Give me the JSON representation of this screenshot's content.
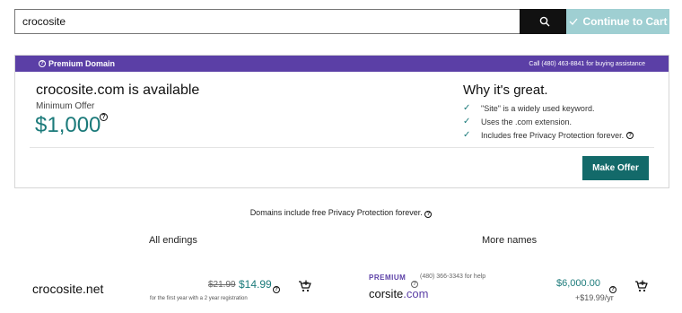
{
  "search": {
    "value": "crocosite",
    "icon": "search-icon",
    "cart_button_label": "Continue to Cart"
  },
  "premium_card": {
    "bar_label": "Premium Domain",
    "bar_phone": "Call (480) 463-8841 for buying assistance",
    "availability": "crocosite.com is available",
    "min_offer_label": "Minimum Offer",
    "price": "$1,000",
    "why_title": "Why it's great.",
    "reasons": [
      "\"Site\" is a widely used keyword.",
      "Uses the .com extension.",
      "Includes free Privacy Protection forever."
    ],
    "make_offer_label": "Make Offer"
  },
  "privacy_note": "Domains include free Privacy Protection forever.",
  "sections": {
    "all_endings": "All endings",
    "more_names": "More names"
  },
  "result_net": {
    "name_base": "crocosite",
    "name_tld": ".net",
    "old_price": "$21.99",
    "price": "$14.99",
    "note": "for the first year with a 2 year registration"
  },
  "result_corsite": {
    "premium_label": "PREMIUM",
    "help_phone": "(480) 366-3343 for help",
    "name_base": "corsite",
    "name_tld": ".com",
    "price": "$6,000.00",
    "renewal": "+$19.99/yr"
  },
  "colors": {
    "accent_teal": "#1b7a7a",
    "button_teal": "#136a6a",
    "premium_purple": "#5b3fa6",
    "cart_disabled": "#9fcfd2"
  }
}
